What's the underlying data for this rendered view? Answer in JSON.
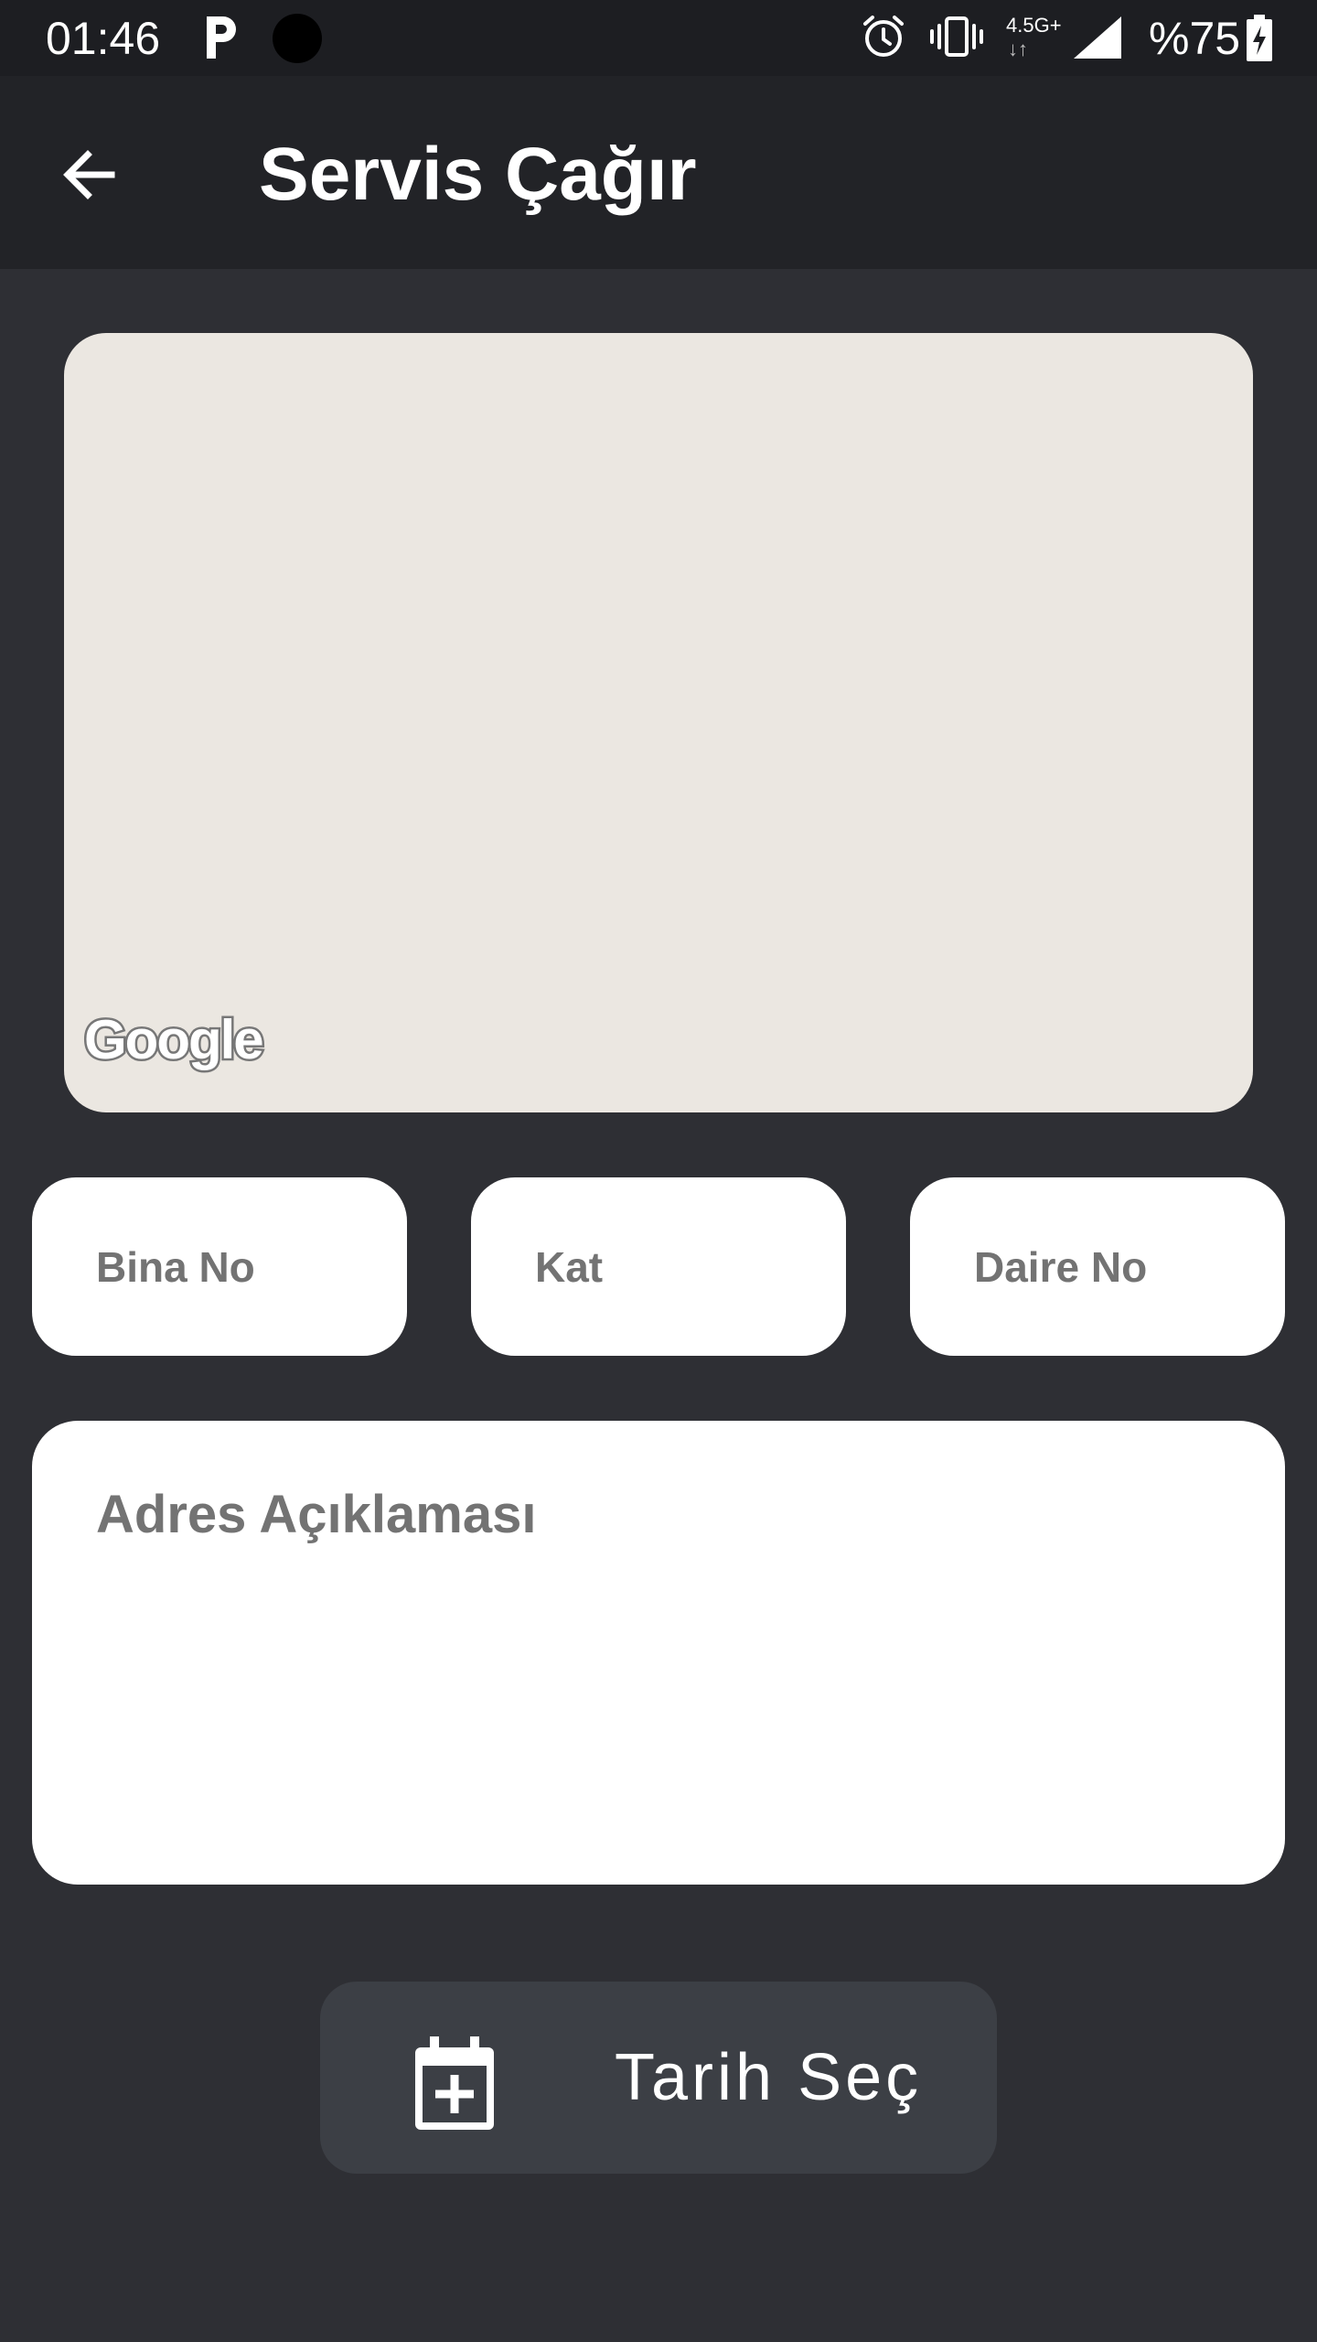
{
  "status_bar": {
    "time": "01:46",
    "network": "4.5G+",
    "network_arrows": "↓↑",
    "battery_text": "%75",
    "icons": [
      "parking-icon",
      "camera-dot-icon",
      "alarm-icon",
      "vibrate-icon",
      "network-icon",
      "signal-icon",
      "battery-charging-icon"
    ]
  },
  "app_bar": {
    "title": "Servis Çağır",
    "back_icon": "arrow-back-icon"
  },
  "map": {
    "attribution": "Google",
    "background_color": "#ebe7e1"
  },
  "fields": {
    "building_placeholder": "Bina No",
    "floor_placeholder": "Kat",
    "apartment_placeholder": "Daire No"
  },
  "address": {
    "placeholder": "Adres Açıklaması"
  },
  "date_button": {
    "label": "Tarih Seç",
    "icon": "calendar-add-icon"
  },
  "colors": {
    "background": "#2e2f34",
    "app_bar": "#222327",
    "status_bar": "#1d1e22",
    "button": "#3c3f45",
    "placeholder": "#737373"
  }
}
